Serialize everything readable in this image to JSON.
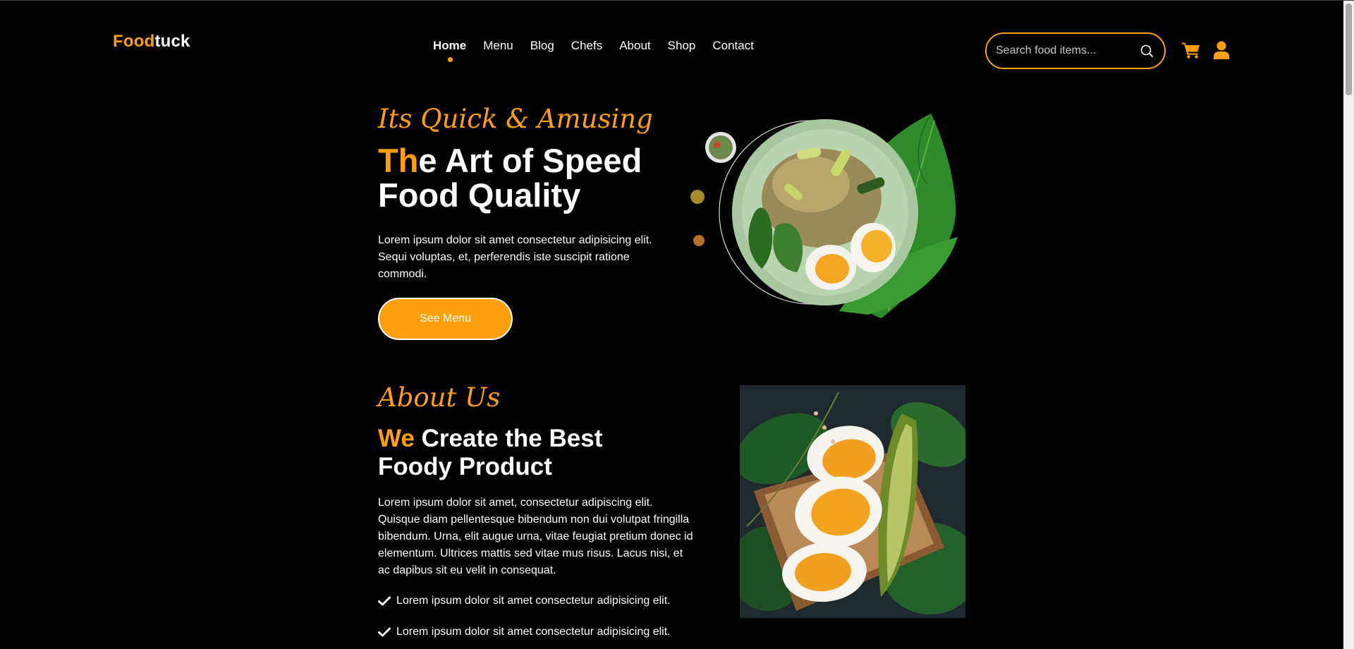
{
  "header": {
    "logo_accent": "Food",
    "logo_rest": "tuck",
    "nav": [
      {
        "label": "Home",
        "active": true
      },
      {
        "label": "Menu"
      },
      {
        "label": "Blog"
      },
      {
        "label": "Chefs"
      },
      {
        "label": "About"
      },
      {
        "label": "Shop"
      },
      {
        "label": "Contact"
      }
    ],
    "search_placeholder": "Search food items...",
    "icons": [
      "search-icon",
      "cart-icon",
      "user-icon"
    ]
  },
  "hero": {
    "tagline": "Its Quick & Amusing",
    "title_highlight": "Th",
    "title_rest_line1": "e Art of Speed",
    "title_line2": "Food Quality",
    "description": "Lorem ipsum dolor sit amet consectetur adipisicing elit. Sequi voluptas, et, perferendis iste suscipit ratione commodi.",
    "button_label": "See Menu"
  },
  "about": {
    "tagline": "About Us",
    "title_highlight": "We",
    "title_rest_line1": " Create the Best",
    "title_line2": "Foody Product",
    "description": "Lorem ipsum dolor sit amet, consectetur adipiscing elit. Quisque diam pellentesque bibendum non dui volutpat fringilla bibendum. Urna, elit augue urna, vitae feugiat pretium donec id elementum. Ultrices mattis sed vitae mus risus. Lacus nisi, et ac dapibus sit eu velit in consequat.",
    "checklist": [
      "Lorem ipsum dolor sit amet consectetur adipisicing elit.",
      "Lorem ipsum dolor sit amet consectetur adipisicing elit."
    ]
  },
  "colors": {
    "accent": "#ff9f0d",
    "background": "#000000",
    "text": "#ffffff"
  }
}
